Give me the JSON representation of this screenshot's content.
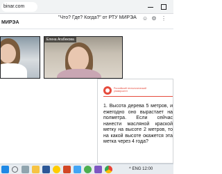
{
  "browser": {
    "url": "binar.com"
  },
  "header": {
    "event_title": "\"Что? Где? Когда?\" от РТУ МИРЭА",
    "org_name": "МИРЭА",
    "icons": [
      "user-icon",
      "settings-icon",
      "more-icon"
    ]
  },
  "participants": [
    {
      "name": ""
    },
    {
      "name": "Елена Агабекова"
    }
  ],
  "slide": {
    "brand_text": "Российский технологический университет",
    "question": "1. Высота дерева 5 метров, и ежегодно оно вырастает на полметра. Если сейчас нанести масляной краской метку на высоте 2 метров, то на какой высоте окажется эта метка через 4 года?"
  },
  "taskbar": {
    "tray_text": "^ ENG 12:00"
  }
}
